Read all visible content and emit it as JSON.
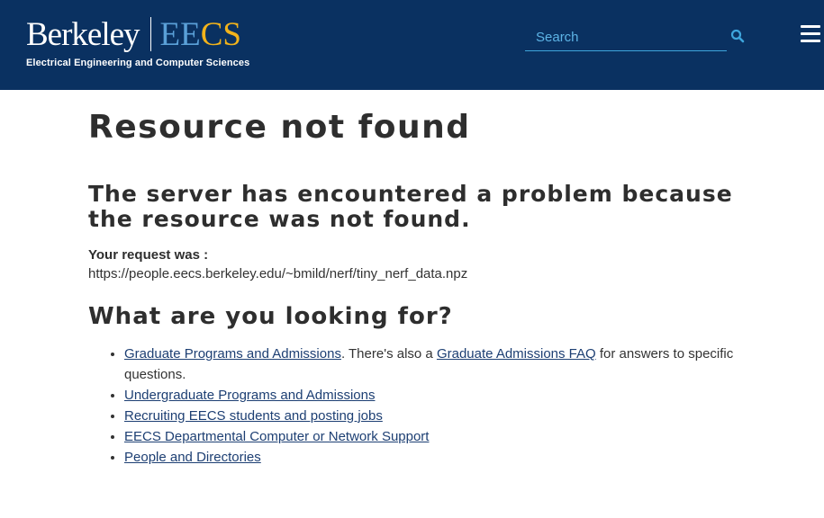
{
  "header": {
    "logo_berkeley": "Berkeley",
    "logo_ee": "EE",
    "logo_cs": "CS",
    "logo_subtitle": "Electrical Engineering and Computer Sciences",
    "search_placeholder": "Search",
    "colors": {
      "header_bg": "#0a3161",
      "ee": "#5aa0d8",
      "cs": "#f2b31b",
      "search_accent": "#3ea5dc"
    }
  },
  "main": {
    "title": "Resource not found",
    "problem_heading": "The server has encountered a problem because the resource was not found.",
    "request_label": "Your request was :",
    "request_url": "https://people.eecs.berkeley.edu/~bmild/nerf/tiny_nerf_data.npz",
    "looking_heading": "What are you looking for?",
    "links": [
      {
        "label": "Graduate Programs and Admissions",
        "mid_text": ". There's also a ",
        "label2": "Graduate Admissions FAQ",
        "tail_text": " for answers to specific questions."
      },
      {
        "label": "Undergraduate Programs and Admissions"
      },
      {
        "label": "Recruiting EECS students and posting jobs"
      },
      {
        "label": "EECS Departmental Computer or Network Support"
      },
      {
        "label": "People and Directories"
      }
    ],
    "link_color": "#1d3f73"
  }
}
